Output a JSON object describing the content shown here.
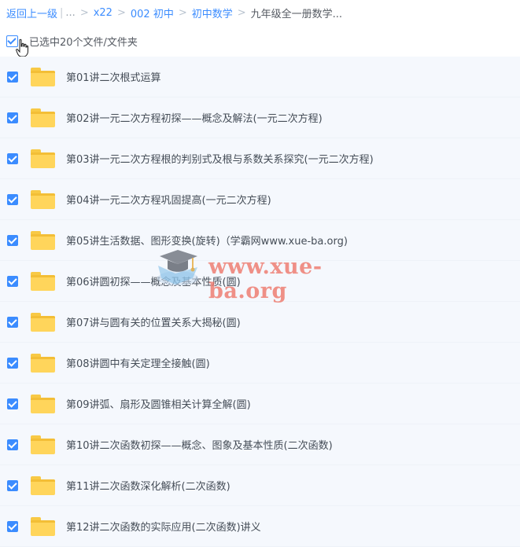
{
  "breadcrumb": {
    "back_label": "返回上一级",
    "ellipsis": "...",
    "items": [
      {
        "label": "x22"
      },
      {
        "label": "002 初中"
      },
      {
        "label": "初中数学"
      },
      {
        "label": "九年级全一册数学..."
      }
    ],
    "separator": ">",
    "divider": "|"
  },
  "selection": {
    "label": "已选中20个文件/文件夹"
  },
  "files": [
    {
      "name": "第01讲二次根式运算",
      "selected": true
    },
    {
      "name": "第02讲一元二次方程初探——概念及解法(一元二次方程)",
      "selected": true
    },
    {
      "name": "第03讲一元二次方程根的判别式及根与系数关系探究(一元二次方程)",
      "selected": true
    },
    {
      "name": "第04讲一元二次方程巩固提高(一元二次方程)",
      "selected": true
    },
    {
      "name": "第05讲生活数据、图形变换(旋转)（学霸网www.xue-ba.org)",
      "selected": true
    },
    {
      "name": "第06讲圆初探——概念及基本性质(圆)",
      "selected": true
    },
    {
      "name": "第07讲与圆有关的位置关系大揭秘(圆)",
      "selected": true
    },
    {
      "name": "第08讲圆中有关定理全接触(圆)",
      "selected": true
    },
    {
      "name": "第09讲弧、扇形及圆锥相关计算全解(圆)",
      "selected": true
    },
    {
      "name": "第10讲二次函数初探——概念、图象及基本性质(二次函数)",
      "selected": true
    },
    {
      "name": "第11讲二次函数深化解析(二次函数)",
      "selected": true
    },
    {
      "name": "第12讲二次函数的实际应用(二次函数)讲义",
      "selected": true
    }
  ],
  "watermark": {
    "text": "www.xue-ba.org"
  },
  "colors": {
    "accent": "#3b8cff",
    "folder": "#ffd55b",
    "list_background": "#f5f8fd"
  }
}
